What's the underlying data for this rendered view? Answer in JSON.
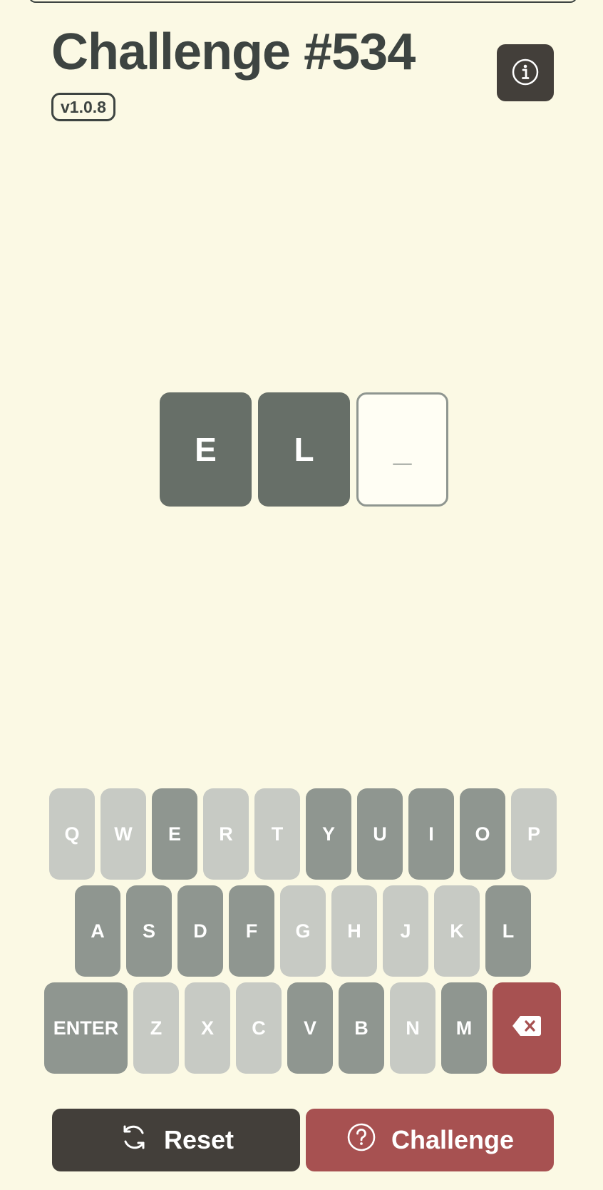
{
  "header": {
    "title": "Challenge #534",
    "version": "v1.0.8"
  },
  "tiles": [
    "E",
    "L",
    "_"
  ],
  "keyboard": {
    "row1": [
      "Q",
      "W",
      "E",
      "R",
      "T",
      "Y",
      "U",
      "I",
      "O",
      "P"
    ],
    "row2": [
      "A",
      "S",
      "D",
      "F",
      "G",
      "H",
      "J",
      "K",
      "L"
    ],
    "row3": [
      "ENTER",
      "Z",
      "X",
      "C",
      "V",
      "B",
      "N",
      "M"
    ],
    "used_letters": [
      "E",
      "Y",
      "U",
      "I",
      "O",
      "A",
      "S",
      "D",
      "F",
      "L",
      "V",
      "B",
      "M"
    ],
    "enter_label": "ENTER",
    "backspace_icon": "backspace-icon"
  },
  "buttons": {
    "reset_label": "Reset",
    "reset_icon": "refresh-icon",
    "challenge_label": "Challenge",
    "challenge_icon": "question-circle-icon"
  },
  "colors": {
    "background": "#fbf9e4",
    "dark": "#433f3a",
    "tile_filled": "#676f68",
    "key_used": "#8f9690",
    "key_unused": "#c7cac4",
    "accent_red": "#a75151"
  }
}
